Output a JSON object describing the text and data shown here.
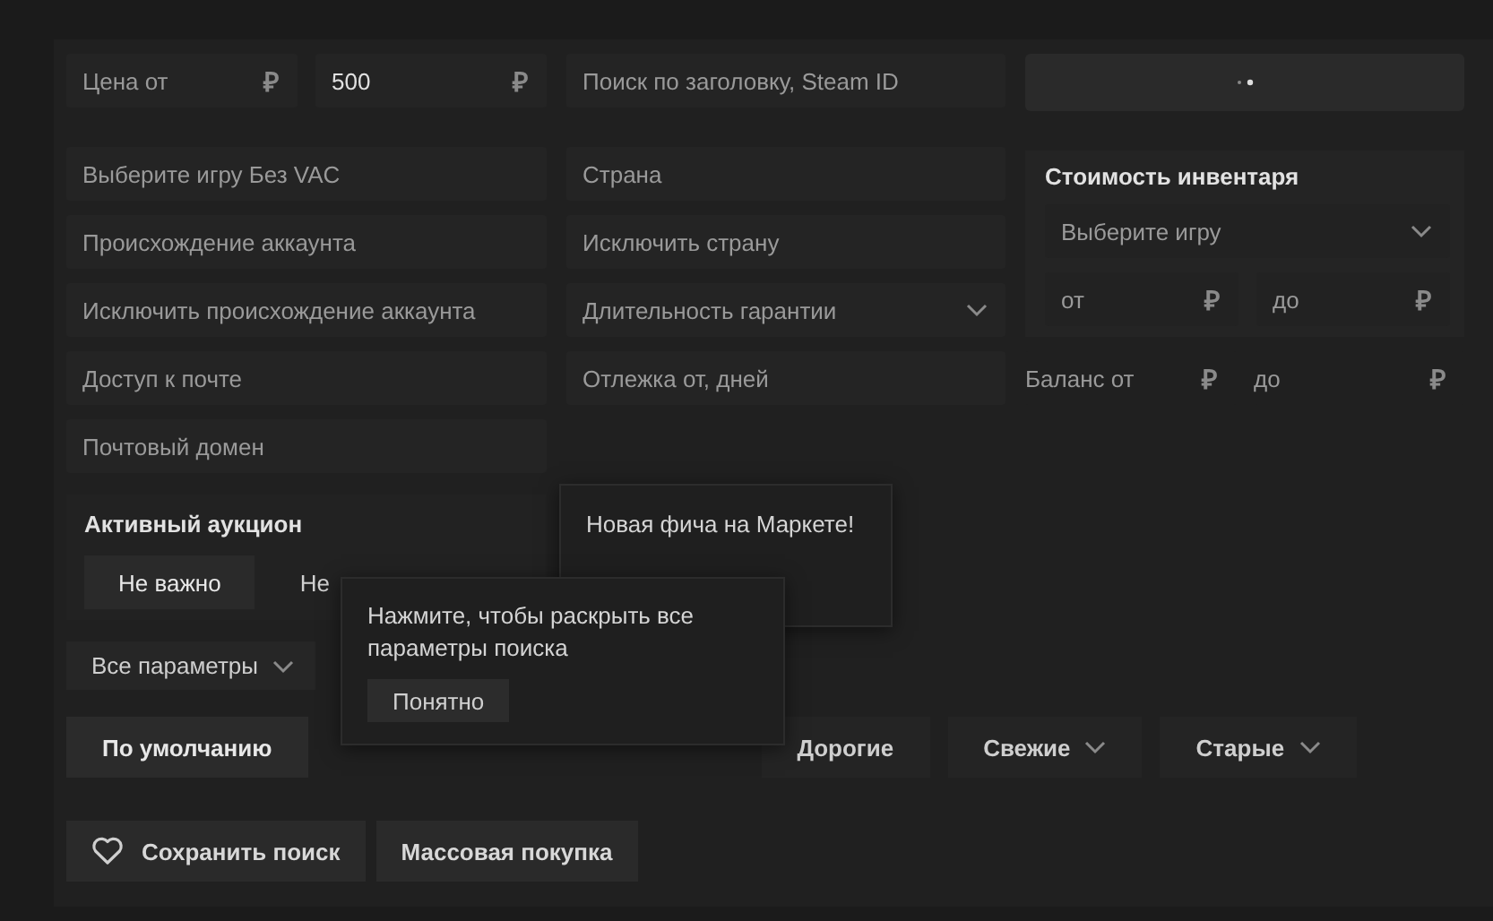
{
  "price": {
    "from": {
      "placeholder": "Цена от",
      "currency": "₽"
    },
    "to": {
      "value": "500",
      "currency": "₽"
    }
  },
  "search": {
    "placeholder": "Поиск по заголовку, Steam ID"
  },
  "column_1": [
    {
      "placeholder": "Выберите игру Без VAC",
      "kind": "input"
    },
    {
      "placeholder": "Происхождение аккаунта",
      "kind": "input"
    },
    {
      "placeholder": "Исключить происхождение аккаунта",
      "kind": "input"
    },
    {
      "placeholder": "Доступ к почте",
      "kind": "input"
    },
    {
      "placeholder": "Почтовый домен",
      "kind": "input"
    }
  ],
  "column_2": [
    {
      "placeholder": "Страна",
      "kind": "input"
    },
    {
      "placeholder": "Исключить страну",
      "kind": "input"
    },
    {
      "placeholder": "Длительность гарантии",
      "kind": "select"
    },
    {
      "placeholder": "Отлежка от, дней",
      "kind": "input"
    }
  ],
  "inventory": {
    "title": "Стоимость инвентаря",
    "game": {
      "placeholder": "Выберите игру"
    },
    "from": {
      "placeholder": "от",
      "currency": "₽"
    },
    "to": {
      "placeholder": "до",
      "currency": "₽"
    }
  },
  "balance": {
    "from": {
      "placeholder": "Баланс от",
      "currency": "₽"
    },
    "to": {
      "placeholder": "до",
      "currency": "₽"
    }
  },
  "auction": {
    "title": "Активный аукцион",
    "options": [
      {
        "label": "Не важно",
        "selected": true,
        "kind": "option"
      },
      {
        "label": "Не",
        "selected": false,
        "kind": "option"
      },
      {
        "kind": "covered"
      }
    ]
  },
  "all_params": {
    "label": "Все параметры"
  },
  "sort": [
    {
      "label": "По умолчанию",
      "selected": true,
      "kind": "plain"
    },
    {
      "kind": "covered"
    },
    {
      "kind": "covered"
    },
    {
      "label": "Дорогие",
      "selected": false,
      "kind": "plain"
    },
    {
      "label": "Свежие",
      "selected": false,
      "kind": "dropdown"
    },
    {
      "label": "Старые",
      "selected": false,
      "kind": "dropdown"
    }
  ],
  "actions": [
    {
      "label": "Сохранить поиск",
      "kind": "favorite"
    },
    {
      "label": "Массовая покупка",
      "kind": "plain"
    }
  ],
  "tooltips": [
    {
      "text": "Новая фича на Маркете!"
    },
    {
      "text": "Нажмите, чтобы раскрыть все параметры поиска",
      "button": "Понятно"
    }
  ]
}
